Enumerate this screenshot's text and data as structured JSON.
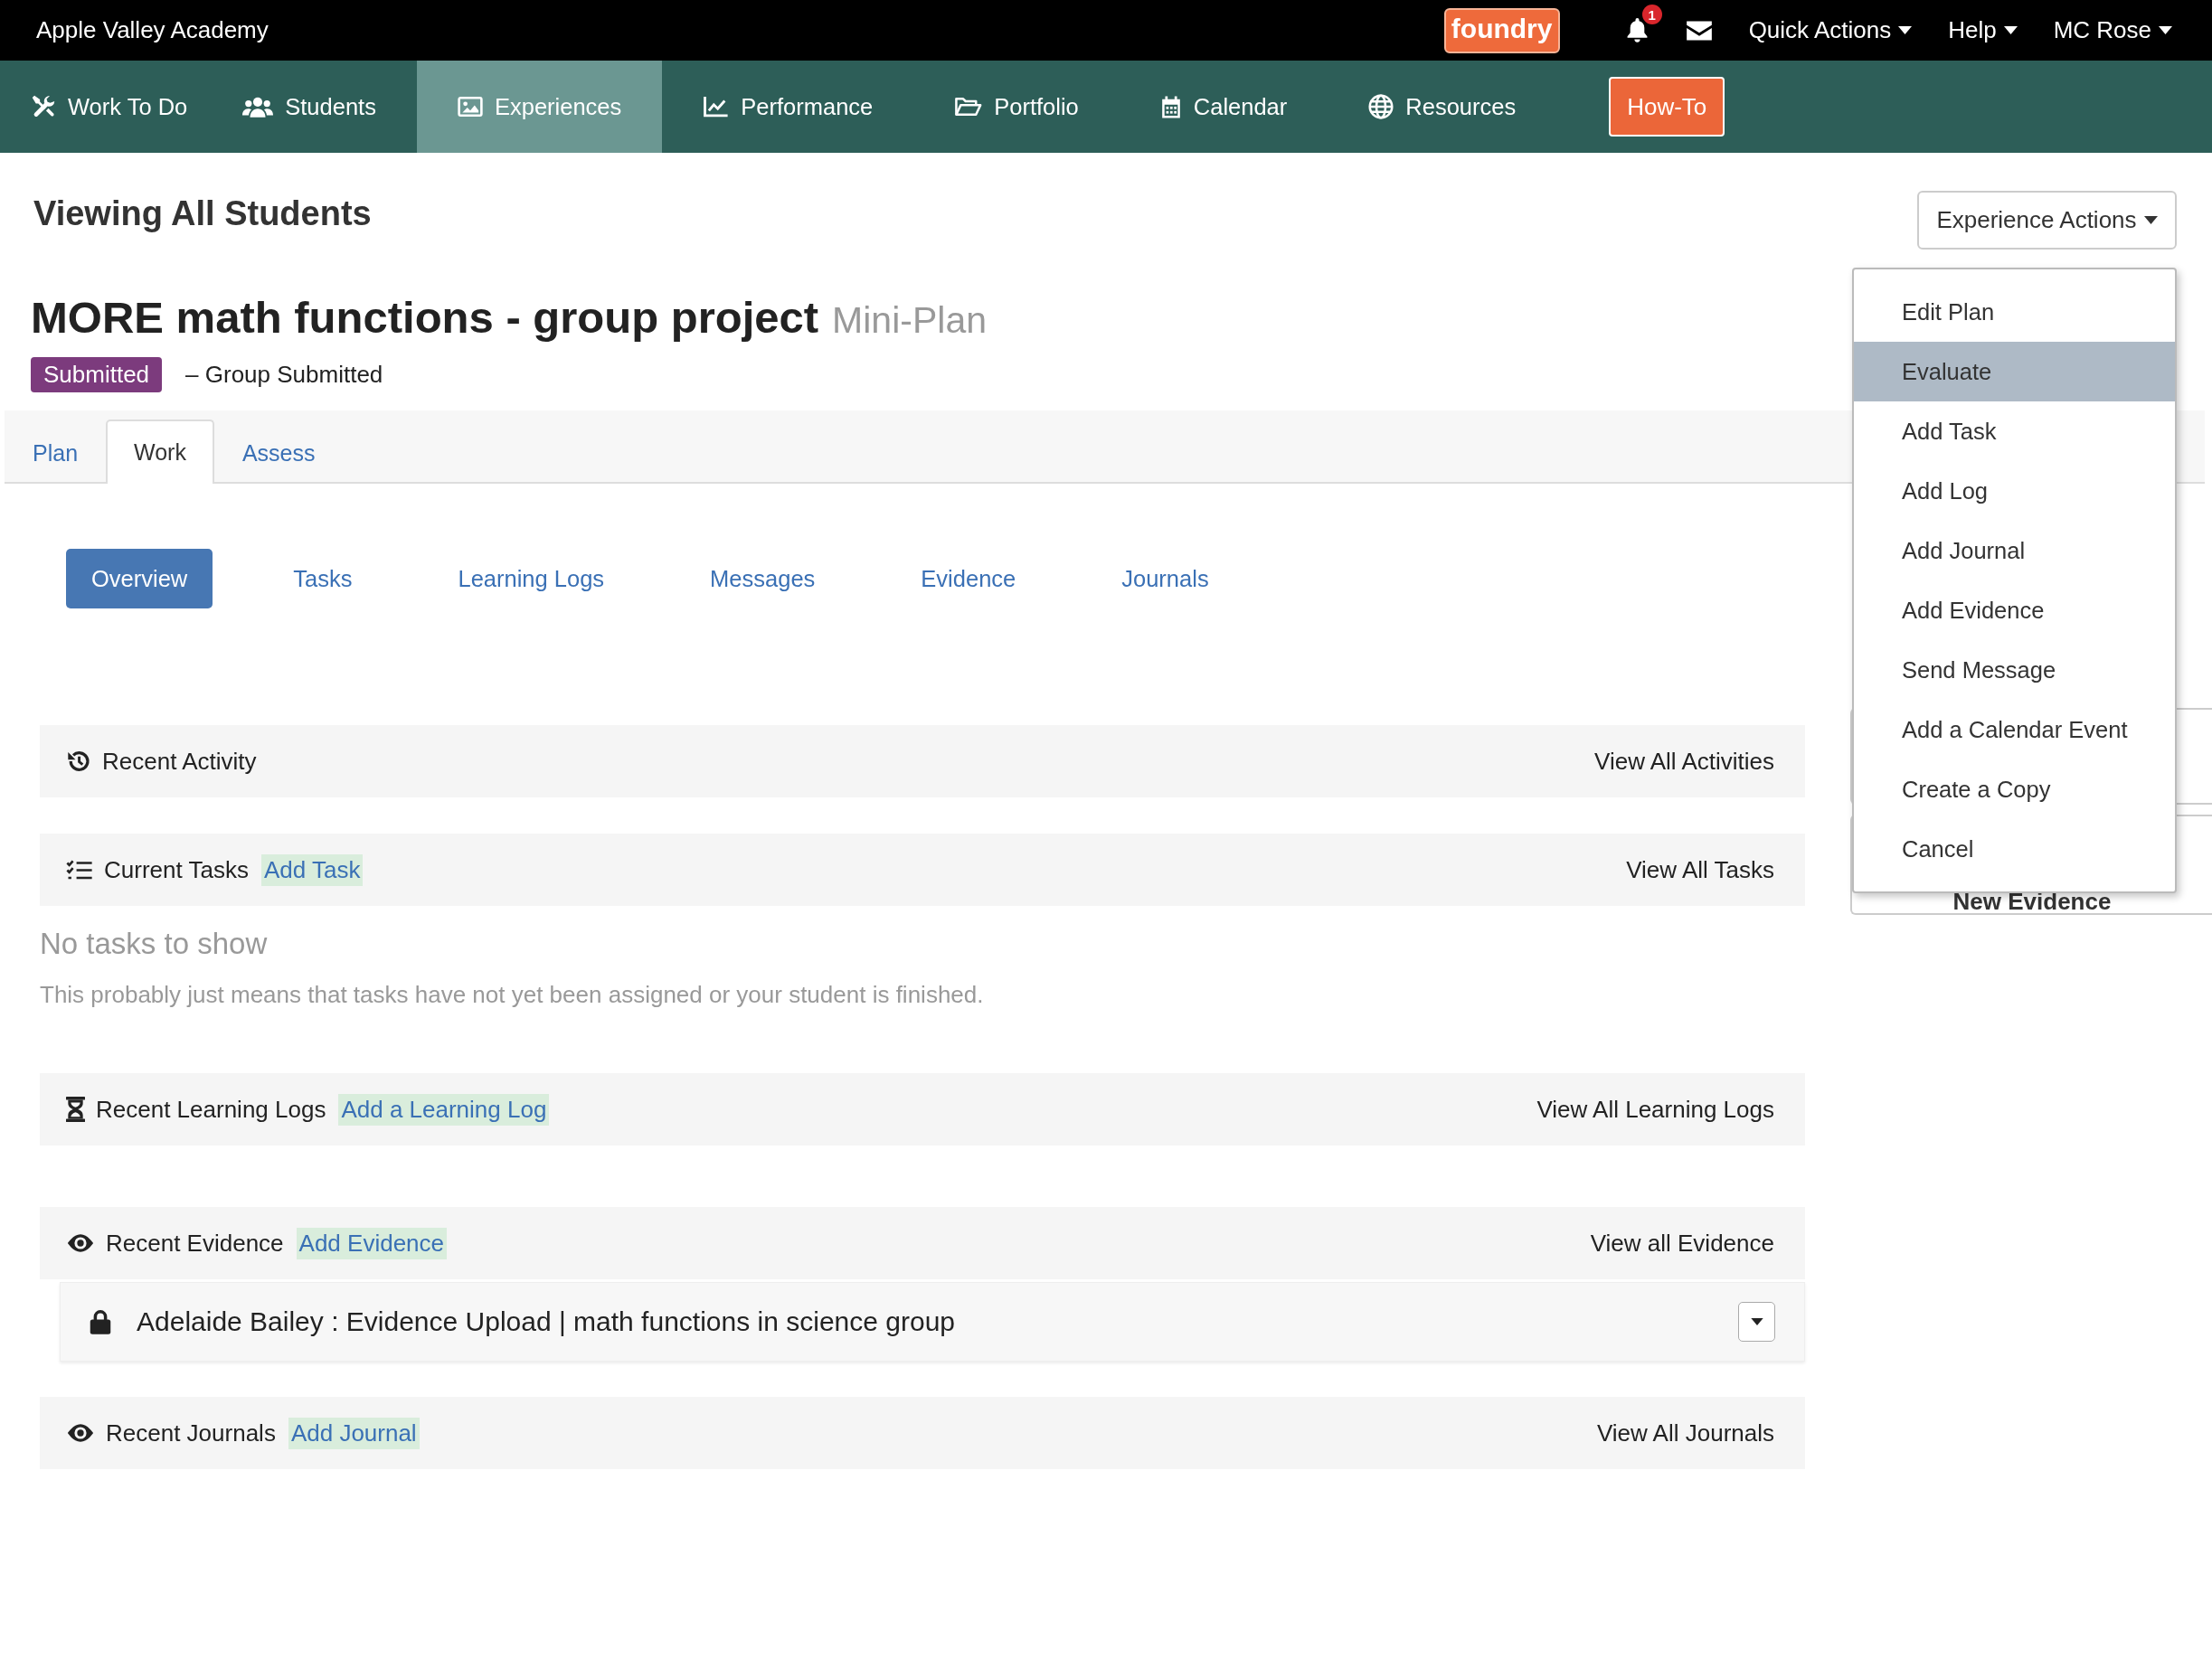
{
  "top_bar": {
    "school": "Apple Valley Academy",
    "logo": "foundry",
    "notification_count": "1",
    "menus": [
      "Quick Actions",
      "Help",
      "MC Rose"
    ]
  },
  "nav": {
    "items": [
      {
        "label": "Work To Do",
        "selected": false
      },
      {
        "label": "Students",
        "selected": false
      },
      {
        "label": "Experiences",
        "selected": true
      },
      {
        "label": "Performance",
        "selected": false
      },
      {
        "label": "Portfolio",
        "selected": false
      },
      {
        "label": "Calendar",
        "selected": false
      },
      {
        "label": "Resources",
        "selected": false
      }
    ],
    "button": "How-To"
  },
  "header": {
    "heading": "Viewing All Students",
    "title": "MORE math functions - group project",
    "plan_type": "Mini-Plan",
    "status": "Submitted",
    "status_note": "– Group Submitted"
  },
  "actions": {
    "label": "Experience Actions",
    "open": true,
    "items": [
      {
        "label": "Edit Plan",
        "selected": false
      },
      {
        "label": "Evaluate",
        "selected": true
      },
      {
        "label": "Add Task",
        "selected": false
      },
      {
        "label": "Add Log",
        "selected": false
      },
      {
        "label": "Add Journal",
        "selected": false
      },
      {
        "label": "Add Evidence",
        "selected": false
      },
      {
        "label": "Send Message",
        "selected": false
      },
      {
        "label": "Add a Calendar Event",
        "selected": false
      },
      {
        "label": "Create a Copy",
        "selected": false
      },
      {
        "label": "Cancel",
        "selected": false
      }
    ]
  },
  "tabs": [
    {
      "label": "Plan",
      "selected": false
    },
    {
      "label": "Work",
      "selected": true
    },
    {
      "label": "Assess",
      "selected": false
    }
  ],
  "subtabs": [
    {
      "label": "Overview",
      "selected": true
    },
    {
      "label": "Tasks",
      "selected": false
    },
    {
      "label": "Learning Logs",
      "selected": false
    },
    {
      "label": "Messages",
      "selected": false
    },
    {
      "label": "Evidence",
      "selected": false
    },
    {
      "label": "Journals",
      "selected": false
    }
  ],
  "sections": [
    {
      "title": "Recent Activity",
      "view_link": "View All Activities"
    },
    {
      "title": "Current Tasks",
      "add_link": "Add Task",
      "view_link": "View All Tasks",
      "empty_title": "No tasks to show",
      "empty_text": "This probably just means that tasks have not yet been assigned or your student is finished."
    },
    {
      "title": "Recent Learning Logs",
      "add_link": "Add a Learning Log",
      "view_link": "View All Learning Logs"
    },
    {
      "title": "Recent Evidence",
      "add_link": "Add Evidence",
      "view_link": "View all Evidence",
      "items": [
        {
          "text": "Adelaide Bailey : Evidence Upload | math functions in science group",
          "locked": true
        }
      ]
    },
    {
      "title": "Recent Journals",
      "add_link": "Add Journal",
      "view_link": "View All Journals"
    }
  ],
  "sidebar": {
    "button": "New Evidence"
  }
}
